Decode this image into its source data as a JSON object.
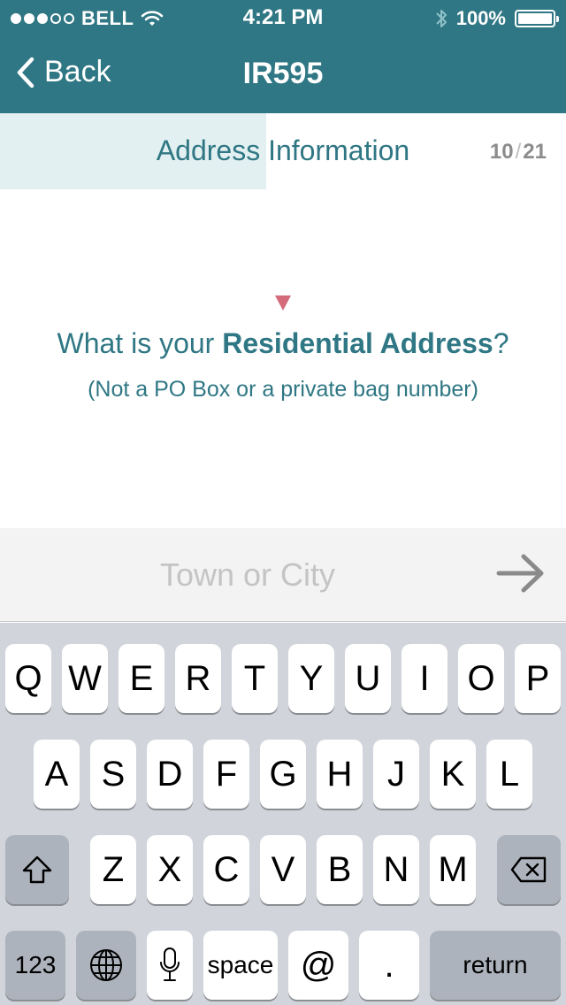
{
  "status_bar": {
    "signal_dots": [
      true,
      true,
      true,
      false,
      false
    ],
    "carrier": "BELL",
    "time": "4:21 PM",
    "battery": "100%",
    "battery_level": 1.0
  },
  "nav": {
    "back_label": "Back",
    "title": "IR595"
  },
  "section": {
    "title": "Address Information",
    "current": "10",
    "total": "21",
    "progress": 0.47
  },
  "question": {
    "prefix": "What is your ",
    "emphasis": "Residential Address",
    "suffix": "?",
    "subtitle": "(Not a PO Box or a private bag number)"
  },
  "input": {
    "placeholder": "Town or City",
    "value": ""
  },
  "keyboard": {
    "row1": [
      "Q",
      "W",
      "E",
      "R",
      "T",
      "Y",
      "U",
      "I",
      "O",
      "P"
    ],
    "row2": [
      "A",
      "S",
      "D",
      "F",
      "G",
      "H",
      "J",
      "K",
      "L"
    ],
    "row3": [
      "Z",
      "X",
      "C",
      "V",
      "B",
      "N",
      "M"
    ],
    "numbers_label": "123",
    "space_label": "space",
    "at_label": "@",
    "dot_label": ".",
    "return_label": "return"
  },
  "colors": {
    "brand": "#2f7784",
    "progress": "#e3f0f1",
    "marker": "#d36b7a",
    "keyboard_bg": "#d1d5db"
  }
}
